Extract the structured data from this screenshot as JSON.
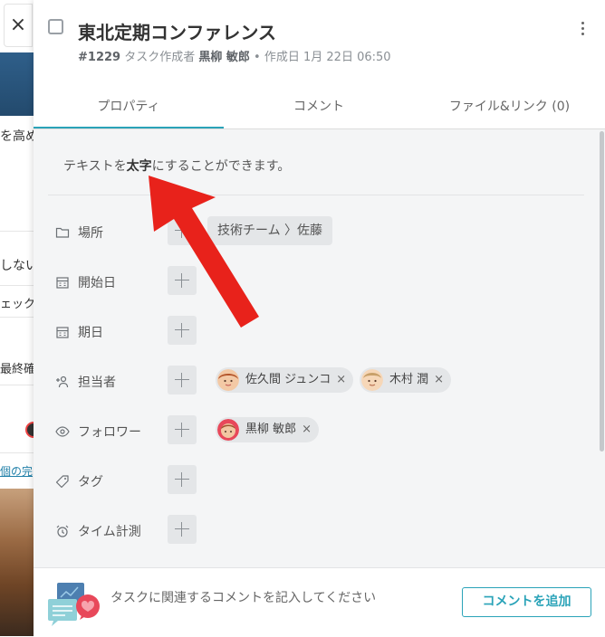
{
  "background": {
    "close_glyph": "×",
    "fragments": [
      "を高め",
      "しない",
      "ェック",
      "最終確認",
      "個の完"
    ]
  },
  "task": {
    "title": "東北定期コンファレンス",
    "id": "#1229",
    "creator_label": "タスク作成者",
    "creator": "黒柳 敏郎",
    "created_label": "• 作成日",
    "created_at": "1月 22日 06:50"
  },
  "tabs": [
    {
      "label": "プロパティ",
      "active": true
    },
    {
      "label": "コメント",
      "active": false
    },
    {
      "label": "ファイル&リンク (0)",
      "active": false
    }
  ],
  "description": {
    "before": "テキストを",
    "bold": "太字",
    "after": "にすることができます。"
  },
  "properties": {
    "location": {
      "label": "場所",
      "icon": "folder-icon",
      "value": "技術チーム 〉佐藤"
    },
    "start_date": {
      "label": "開始日",
      "icon": "calendar-icon"
    },
    "due_date": {
      "label": "期日",
      "icon": "calendar-icon"
    },
    "assignee": {
      "label": "担当者",
      "icon": "add-person-icon",
      "people": [
        {
          "name": "佐久間 ジュンコ",
          "remove": "×"
        },
        {
          "name": "木村 潤",
          "remove": "×"
        }
      ]
    },
    "followers": {
      "label": "フォロワー",
      "icon": "eye-icon",
      "people": [
        {
          "name": "黒柳 敏郎",
          "remove": "×"
        }
      ]
    },
    "tags": {
      "label": "タグ",
      "icon": "tag-icon"
    },
    "time_tracking": {
      "label": "タイム計測",
      "icon": "alarm-clock-icon"
    }
  },
  "footer": {
    "prompt": "タスクに関連するコメントを記入してください",
    "add_comment_label": "コメントを追加"
  },
  "colors": {
    "accent": "#2aa3b8",
    "annotation_arrow": "#e8221b",
    "panel_body": "#f4f5f6"
  }
}
